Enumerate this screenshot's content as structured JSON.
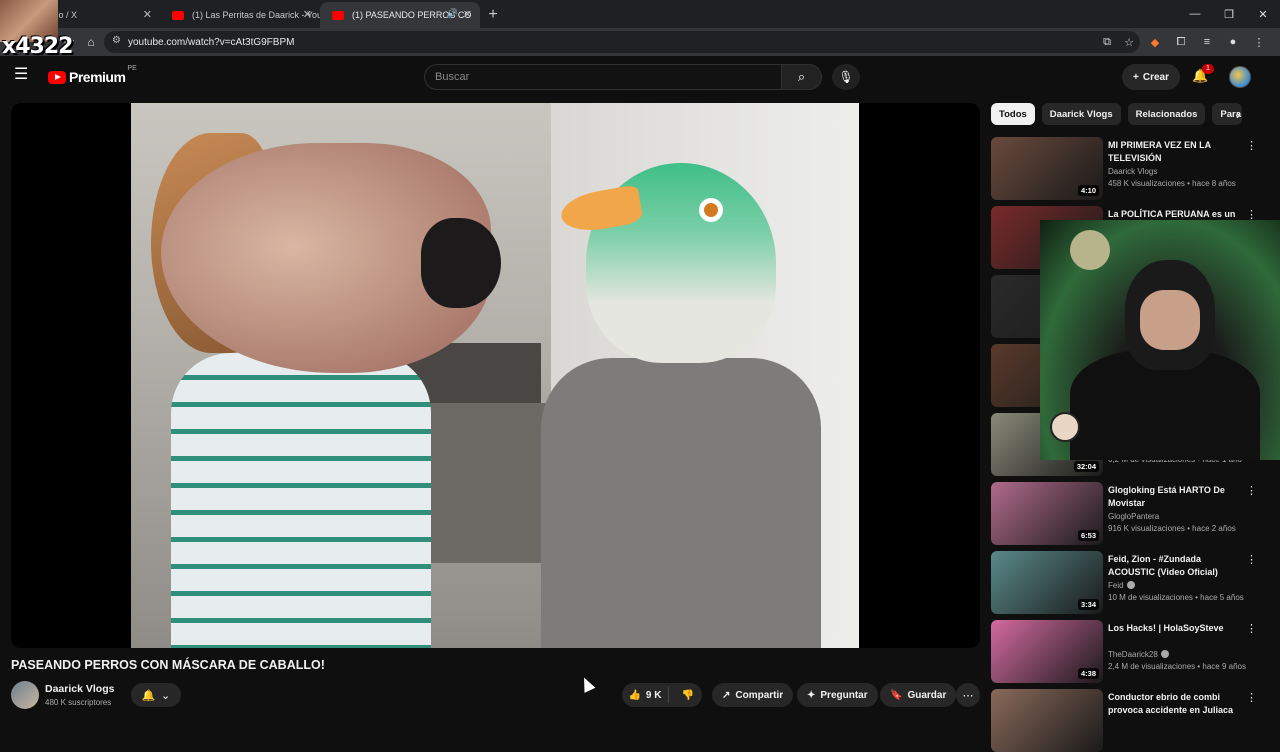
{
  "browser": {
    "tabs": [
      {
        "label": "5) Inicio / X",
        "icon": "x-logo-icon"
      },
      {
        "label": "(1) Las Perritas de Daarick - You",
        "icon": "youtube-icon"
      },
      {
        "label": "(1) PASEANDO PERROS CO",
        "icon": "youtube-icon",
        "active": true
      }
    ],
    "url": "youtube.com/watch?v=cAt3tG9FBPM"
  },
  "overlay": {
    "number": "x4322"
  },
  "header": {
    "logo_text": "Premium",
    "logo_country": "PE",
    "search_placeholder": "Buscar",
    "create_label": "Crear",
    "notifications_count": "1"
  },
  "video": {
    "title": "PASEANDO PERROS CON MÁSCARA DE CABALLO!",
    "channel": "Daarick Vlogs",
    "subscribers": "480 K suscriptores",
    "likes": "9 K",
    "share_label": "Compartir",
    "ask_label": "Preguntar",
    "save_label": "Guardar"
  },
  "sidebar": {
    "chips": [
      "Todos",
      "Daarick Vlogs",
      "Relacionados",
      "Para"
    ],
    "recommendations": [
      {
        "title": "MI PRIMERA VEZ EN LA TELEVISIÓN",
        "channel": "Daarick Vlogs",
        "meta": "458 K visualizaciones • hace 8 años",
        "duration": "4:10",
        "thumb_color": "#6a4a3c"
      },
      {
        "title": "La POLÍTICA PERUANA es un",
        "channel": "",
        "meta": "",
        "duration": "",
        "thumb_color": "#7a2a2a"
      },
      {
        "title": "",
        "channel": "",
        "meta": "",
        "duration": "",
        "thumb_color": "#2a2a2a"
      },
      {
        "title": "",
        "channel": "",
        "meta": "",
        "duration": "",
        "thumb_color": "#5a3a2a"
      },
      {
        "title": "",
        "channel": "",
        "meta": "6,2 M de visualizaciones • hace 1 año",
        "duration": "32:04",
        "thumb_color": "#8a8a7a"
      },
      {
        "title": "Glogloking Está HARTO De Movistar",
        "channel": "GlogloPantera",
        "meta": "916 K visualizaciones • hace 2 años",
        "duration": "6:53",
        "thumb_color": "#b06a8a"
      },
      {
        "title": "Feid, Zion - #Zundada ACOUSTIC (Video Oficial)",
        "channel": "Feid",
        "meta": "10 M de visualizaciones • hace 5 años",
        "duration": "3:34",
        "thumb_color": "#5a8a8a"
      },
      {
        "title": "Los Hacks! | HolaSoySteve",
        "channel": "TheDaarick28",
        "meta": "2,4 M de visualizaciones • hace 9 años",
        "duration": "4:38",
        "thumb_color": "#d46aa0"
      },
      {
        "title": "Conductor ebrio de combi provoca accidente en Juliaca",
        "channel": "",
        "meta": "",
        "duration": "",
        "thumb_color": "#8a6a5a"
      }
    ]
  }
}
